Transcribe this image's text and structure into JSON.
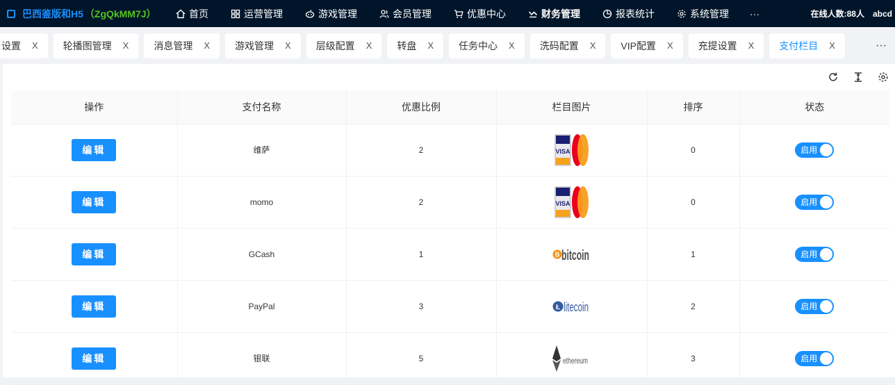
{
  "header": {
    "brand": "巴西鉴版和H5",
    "brand_code": "（ZgQkMM7J）",
    "nav": [
      {
        "label": "首页",
        "icon": "home-icon"
      },
      {
        "label": "运营管理",
        "icon": "grid-icon"
      },
      {
        "label": "游戏管理",
        "icon": "game-icon"
      },
      {
        "label": "会员管理",
        "icon": "users-icon"
      },
      {
        "label": "优惠中心",
        "icon": "cart-icon"
      },
      {
        "label": "财务管理",
        "icon": "finance-icon",
        "active": true
      },
      {
        "label": "报表统计",
        "icon": "pie-icon"
      },
      {
        "label": "系统管理",
        "icon": "gear-icon"
      }
    ],
    "more": "···",
    "online": "在线人数:88人",
    "user": "abcd"
  },
  "tabs": [
    {
      "label": "设置"
    },
    {
      "label": "轮播图管理"
    },
    {
      "label": "消息管理"
    },
    {
      "label": "游戏管理"
    },
    {
      "label": "层级配置"
    },
    {
      "label": "转盘"
    },
    {
      "label": "任务中心"
    },
    {
      "label": "洗码配置"
    },
    {
      "label": "VIP配置"
    },
    {
      "label": "充提设置"
    },
    {
      "label": "支付栏目",
      "active": true
    }
  ],
  "tab_close": "X",
  "tabs_more": "···",
  "table": {
    "columns": [
      "操作",
      "支付名称",
      "优惠比例",
      "栏目图片",
      "排序",
      "状态"
    ],
    "edit_label": "编辑",
    "rows": [
      {
        "name": "维萨",
        "ratio": "2",
        "image": "visa-mastercard",
        "sort": "0",
        "status": "启用"
      },
      {
        "name": "momo",
        "ratio": "2",
        "image": "visa-mastercard",
        "sort": "0",
        "status": "启用"
      },
      {
        "name": "GCash",
        "ratio": "1",
        "image": "bitcoin",
        "sort": "1",
        "status": "启用"
      },
      {
        "name": "PayPal",
        "ratio": "3",
        "image": "litecoin",
        "sort": "2",
        "status": "启用"
      },
      {
        "name": "银联",
        "ratio": "5",
        "image": "ethereum",
        "sort": "3",
        "status": "启用"
      }
    ]
  },
  "image_text": {
    "visa": "VISA",
    "bitcoin": "bitcoin",
    "litecoin": "litecoin",
    "ethereum": "ethereum"
  },
  "colors": {
    "primary": "#1890ff",
    "header_bg": "#001529",
    "brand_code": "#52c41a"
  }
}
